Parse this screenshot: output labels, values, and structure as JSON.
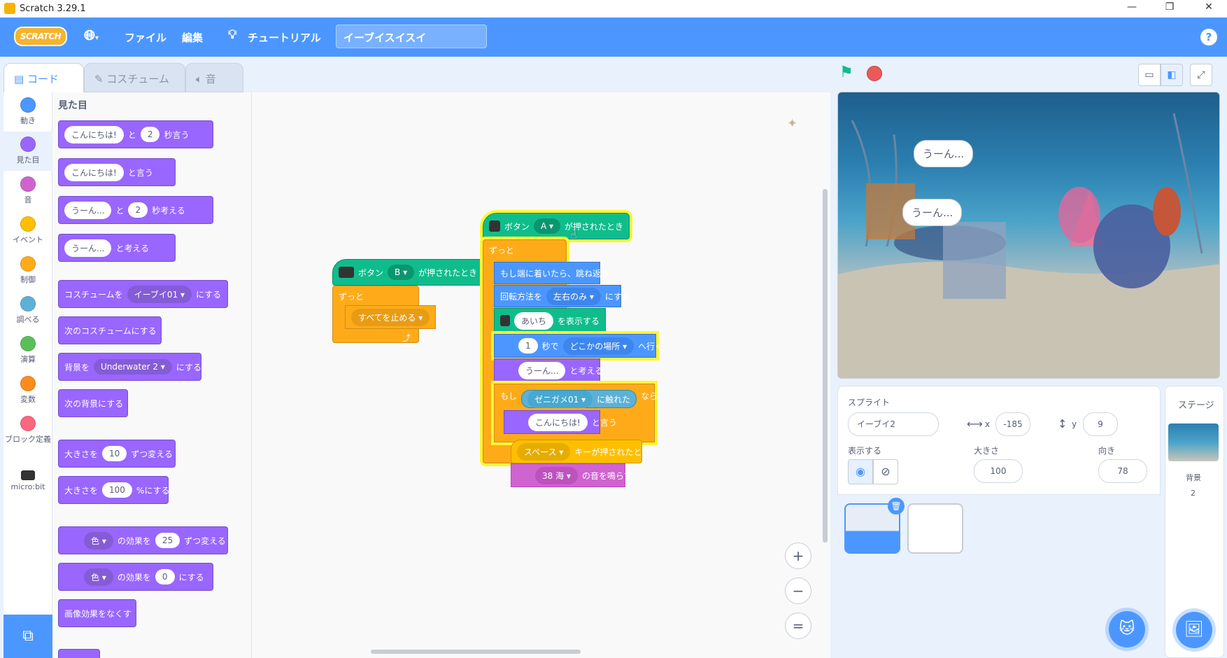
{
  "window": {
    "title": "Scratch 3.29.1",
    "min": "—",
    "max": "❐",
    "close": "✕"
  },
  "menu": {
    "logo": "SCRATCH",
    "language_icon": "globe-icon",
    "file": "ファイル",
    "edit": "編集",
    "tutorial": "チュートリアル",
    "project_title": "イーブイスイスイ",
    "help": "?"
  },
  "tabs": [
    {
      "label": "コード"
    },
    {
      "label": "コスチューム"
    },
    {
      "label": "音"
    }
  ],
  "categories": [
    {
      "label": "動き",
      "color": "#4c97ff"
    },
    {
      "label": "見た目",
      "color": "#9966ff"
    },
    {
      "label": "音",
      "color": "#cf63cf"
    },
    {
      "label": "イベント",
      "color": "#ffbf00"
    },
    {
      "label": "制御",
      "color": "#ffab19"
    },
    {
      "label": "調べる",
      "color": "#5cb1d6"
    },
    {
      "label": "演算",
      "color": "#59c059"
    },
    {
      "label": "変数",
      "color": "#ff8c1a"
    },
    {
      "label": "ブロック定義",
      "color": "#ff6680"
    },
    {
      "label": "micro:bit",
      "color": "#0fbd8c"
    }
  ],
  "palette": {
    "title": "見た目",
    "b1": {
      "a": "こんにちは!",
      "b": "と",
      "c": "2",
      "d": "秒言う"
    },
    "b2": {
      "a": "こんにちは!",
      "b": "と言う"
    },
    "b3": {
      "a": "うーん...",
      "b": "と",
      "c": "2",
      "d": "秒考える"
    },
    "b4": {
      "a": "うーん...",
      "b": "と考える"
    },
    "b5": {
      "a": "コスチュームを",
      "b": "イーブイ01 ▾",
      "c": "にする"
    },
    "b6": {
      "a": "次のコスチュームにする"
    },
    "b7": {
      "a": "背景を",
      "b": "Underwater 2 ▾",
      "c": "にする"
    },
    "b8": {
      "a": "次の背景にする"
    },
    "b9": {
      "a": "大きさを",
      "b": "10",
      "c": "ずつ変える"
    },
    "b10": {
      "a": "大きさを",
      "b": "100",
      "c": "%にする"
    },
    "b11": {
      "a": "色 ▾",
      "b": "の効果を",
      "c": "25",
      "d": "ずつ変える"
    },
    "b12": {
      "a": "色 ▾",
      "b": "の効果を",
      "c": "0",
      "d": "にする"
    },
    "b13": {
      "a": "画像効果をなくす"
    }
  },
  "scriptB": {
    "hat_a": "ボタン",
    "hat_dd": "B ▾",
    "hat_b": "が押されたとき",
    "forever": "ずっと",
    "stop": "すべてを止める ▾",
    "arrow": "⤴"
  },
  "scriptA": {
    "hat_a": "ボタン",
    "hat_dd": "A ▾",
    "hat_b": "が押されたとき",
    "forever": "ずっと",
    "bounce": "もし端に着いたら、跳ね返る",
    "rot_a": "回転方法を",
    "rot_dd": "左右のみ ▾",
    "rot_b": "にする",
    "show_dd": "あいち",
    "show_b": "を表示する",
    "glide_n": "1",
    "glide_a": "秒で",
    "glide_dd": "どこかの場所 ▾",
    "glide_b": "へ行く",
    "think_a": "うーん...",
    "think_b": "と考える",
    "if_a": "もし",
    "if_dd": "ゼニガメ01 ▾",
    "if_b": "に触れた",
    "if_c": "なら",
    "say_a": "こんにちは!",
    "say_b": "と言う",
    "arrow": "⤴"
  },
  "scriptKey": {
    "dd": "スペース ▾",
    "b": "キーが押されたとき",
    "sound_dd": "38 海 ▾",
    "sound_b": "の音を鳴らす"
  },
  "zoom": {
    "in": "+",
    "out": "−",
    "reset": "="
  },
  "stage": {
    "bubble1": "うーん...",
    "bubble2": "うーん..."
  },
  "sprite_info": {
    "sprite_label": "スプライト",
    "sprite_name": "イーブイ2",
    "x_label": "x",
    "x": "-185",
    "y_label": "y",
    "y": "9",
    "show_label": "表示する",
    "size_label": "大きさ",
    "size": "100",
    "dir_label": "向き",
    "direction": "78"
  },
  "stage_pane": {
    "label": "ステージ",
    "bg_label": "背景",
    "bg_count": "2"
  }
}
